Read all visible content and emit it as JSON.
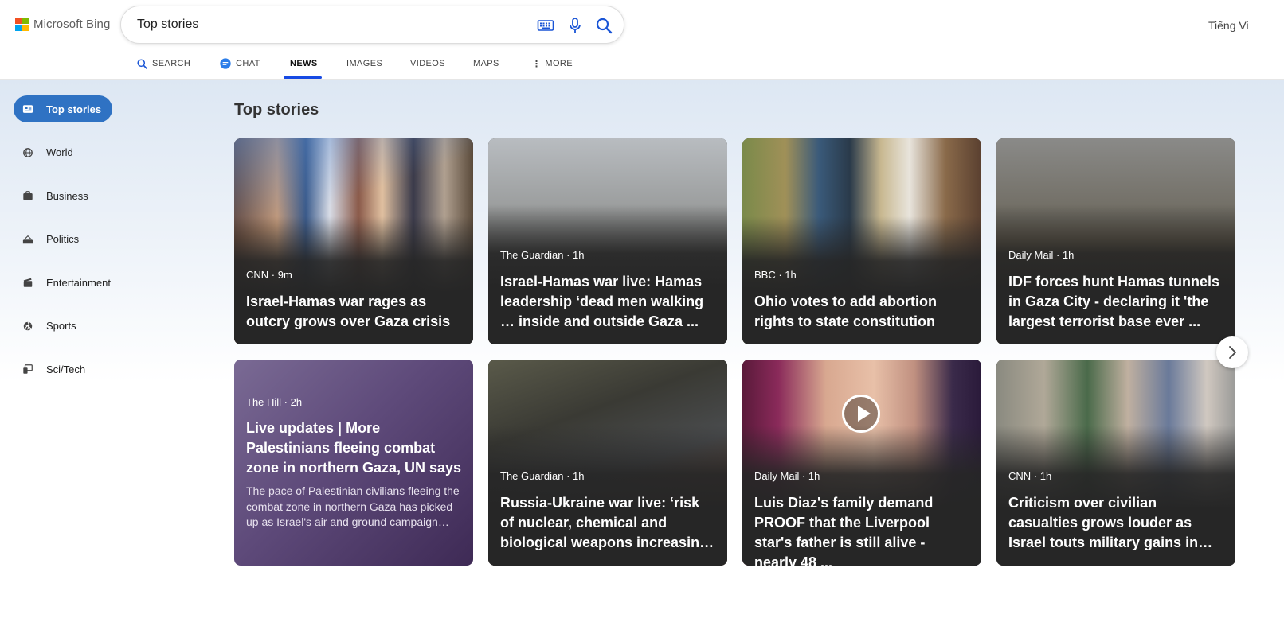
{
  "header": {
    "logo_text": "Microsoft Bing",
    "search_value": "Top stories",
    "language": "Tiếng Vi"
  },
  "tabs": [
    {
      "label": "SEARCH"
    },
    {
      "label": "CHAT"
    },
    {
      "label": "NEWS"
    },
    {
      "label": "IMAGES"
    },
    {
      "label": "VIDEOS"
    },
    {
      "label": "MAPS"
    },
    {
      "label": "MORE"
    }
  ],
  "sidebar": {
    "items": [
      {
        "label": "Top stories",
        "icon": "newspaper-icon"
      },
      {
        "label": "World",
        "icon": "globe-icon"
      },
      {
        "label": "Business",
        "icon": "briefcase-icon"
      },
      {
        "label": "Politics",
        "icon": "podium-icon"
      },
      {
        "label": "Entertainment",
        "icon": "clapperboard-icon"
      },
      {
        "label": "Sports",
        "icon": "volleyball-icon"
      },
      {
        "label": "Sci/Tech",
        "icon": "devices-icon"
      }
    ]
  },
  "section_title": "Top stories",
  "cards": [
    {
      "source": "CNN · 9m",
      "title": "Israel-Hamas war rages as outcry grows over Gaza crisis"
    },
    {
      "source": "The Guardian · 1h",
      "title": "Israel-Hamas war live: Hamas leadership ‘dead men walking … inside and outside Gaza ..."
    },
    {
      "source": "BBC · 1h",
      "title": "Ohio votes to add abortion rights to state constitution"
    },
    {
      "source": "Daily Mail · 1h",
      "title": "IDF forces hunt Hamas tunnels in Gaza City - declaring it 'the largest terrorist base ever ..."
    },
    {
      "source": "The Hill · 2h",
      "title": "Live updates | More Palestinians fleeing combat zone in northern Gaza, UN says",
      "snippet": "The pace of Palestinian civilians fleeing the combat zone in northern Gaza has picked up as Israel's air and ground campaign…"
    },
    {
      "source": "The Guardian · 1h",
      "title": "Russia-Ukraine war live: ‘risk of nuclear, chemical and biological weapons increasin…"
    },
    {
      "source": "Daily Mail · 1h",
      "title": "Luis Diaz's family demand PROOF that the Liverpool star's father is still alive - nearly 48 ..."
    },
    {
      "source": "CNN · 1h",
      "title": "Criticism over civilian casualties grows louder as Israel touts military gains in…"
    }
  ],
  "colors": {
    "accent": "#174ae4",
    "sidebar_active": "#2f72c3",
    "card_bg": "#262626"
  }
}
